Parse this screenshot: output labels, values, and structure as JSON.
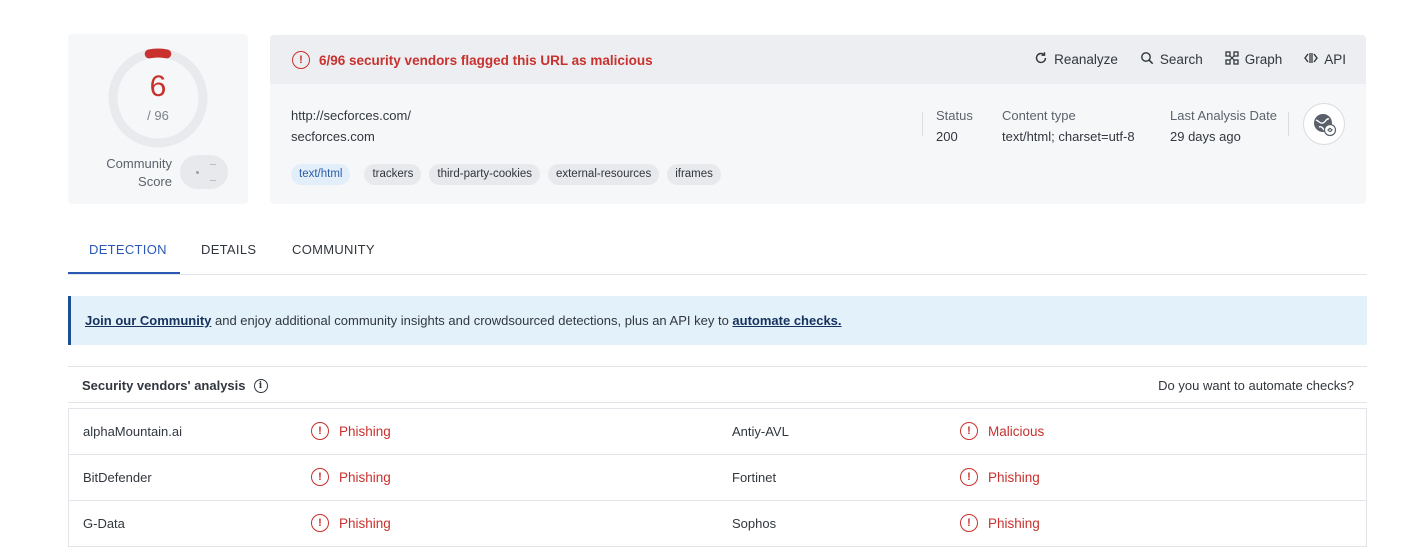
{
  "score": {
    "detections": "6",
    "total": "/ 96",
    "community_label_line1": "Community",
    "community_label_line2": "Score",
    "flagged_fraction": 0.0625
  },
  "alert": {
    "text": "6/96 security vendors flagged this URL as malicious",
    "color": "#c8312d"
  },
  "actions": [
    {
      "label": "Reanalyze",
      "icon": "refresh-icon"
    },
    {
      "label": "Search",
      "icon": "search-icon"
    },
    {
      "label": "Graph",
      "icon": "graph-icon"
    },
    {
      "label": "API",
      "icon": "api-icon"
    }
  ],
  "target": {
    "url": "http://secforces.com/",
    "domain": "secforces.com"
  },
  "meta": {
    "status_label": "Status",
    "status_value": "200",
    "content_type_label": "Content type",
    "content_type_value": "text/html; charset=utf-8",
    "last_analysis_label": "Last Analysis Date",
    "last_analysis_value": "29 days ago"
  },
  "tags": [
    "text/html",
    "trackers",
    "third-party-cookies",
    "external-resources",
    "iframes"
  ],
  "tabs": [
    {
      "label": "DETECTION",
      "active": true
    },
    {
      "label": "DETAILS",
      "active": false
    },
    {
      "label": "COMMUNITY",
      "active": false
    }
  ],
  "banner": {
    "link1": "Join our Community",
    "middle": " and enjoy additional community insights and crowdsourced detections, plus an API key to ",
    "link2": "automate checks."
  },
  "vendors": {
    "title": "Security vendors' analysis",
    "automate_prompt": "Do you want to automate checks?",
    "rows": [
      {
        "left_name": "alphaMountain.ai",
        "left_result": "Phishing",
        "right_name": "Antiy-AVL",
        "right_result": "Malicious"
      },
      {
        "left_name": "BitDefender",
        "left_result": "Phishing",
        "right_name": "Fortinet",
        "right_result": "Phishing"
      },
      {
        "left_name": "G-Data",
        "left_result": "Phishing",
        "right_name": "Sophos",
        "right_result": "Phishing"
      }
    ]
  },
  "colors": {
    "malicious_red": "#c8312d",
    "accent_blue": "#2a58b3",
    "banner_bg": "#e3f1fb"
  }
}
